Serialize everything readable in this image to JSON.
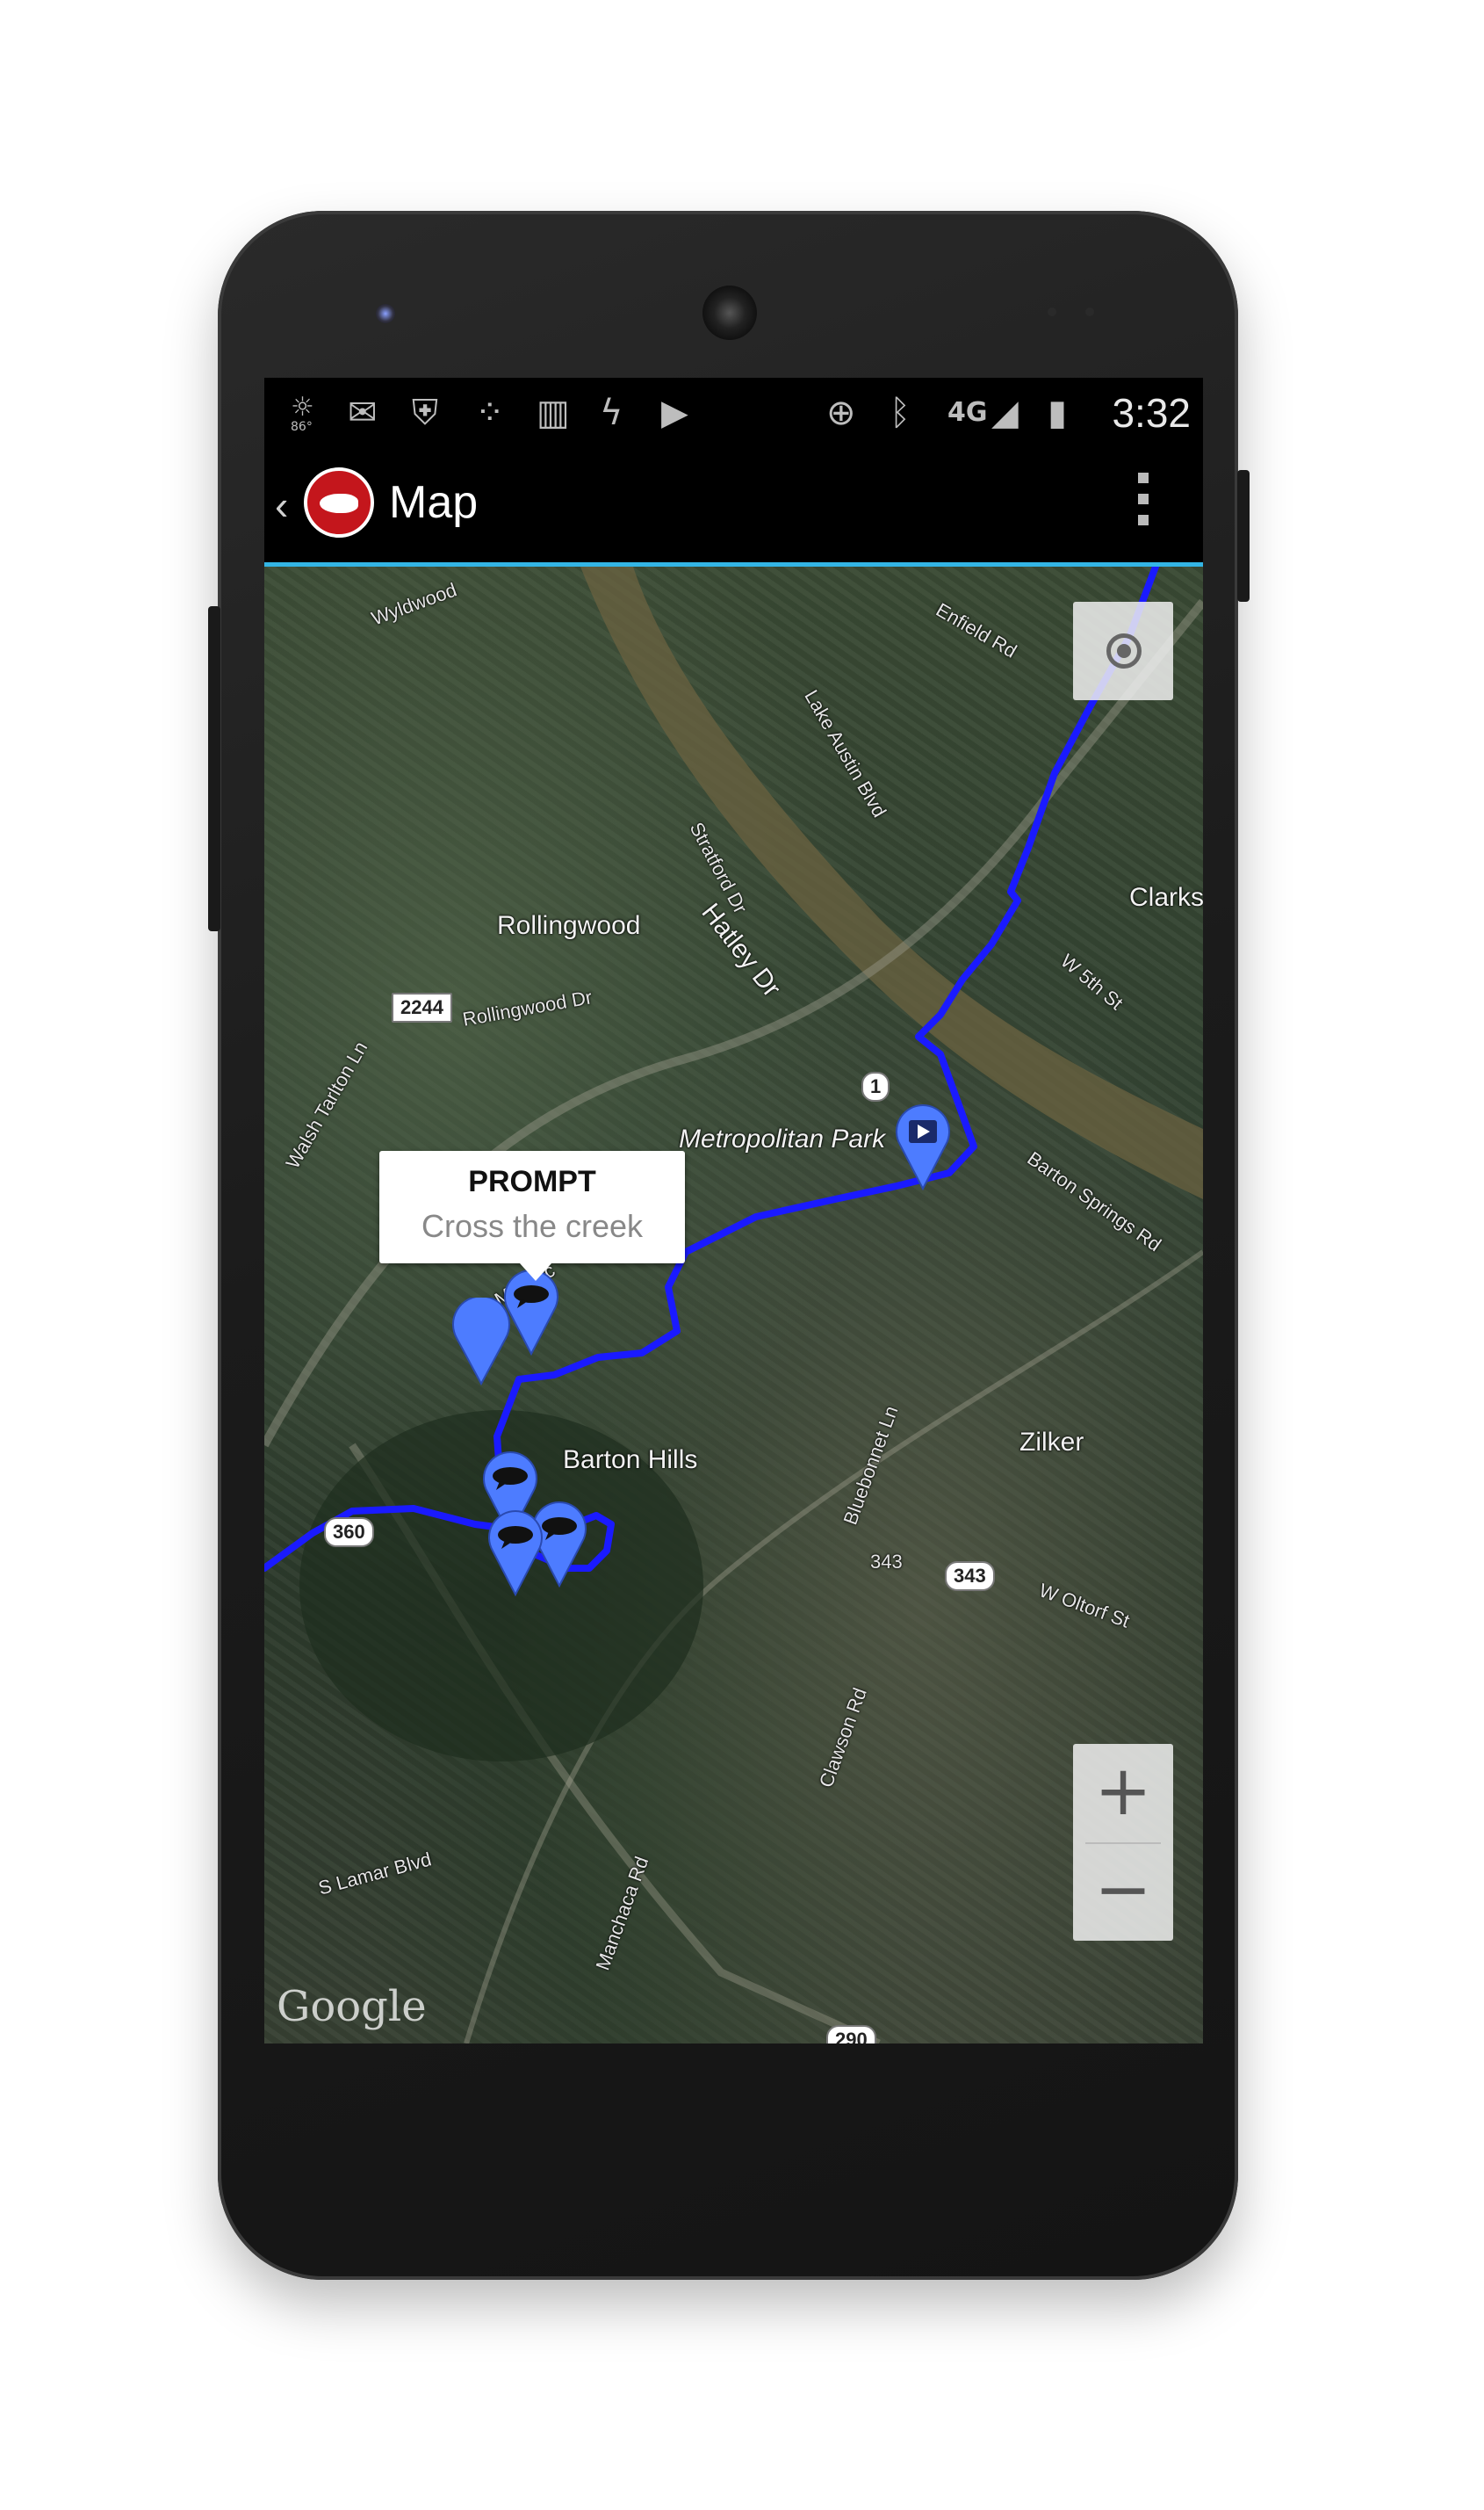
{
  "statusbar": {
    "icons": [
      "weather-icon",
      "gmail-icon",
      "shield-icon",
      "dots-icon",
      "barcode-icon",
      "charging-icon",
      "play-store-icon",
      "gps-icon",
      "bluetooth-icon",
      "network-icon",
      "signal-icon",
      "battery-icon"
    ],
    "weather_temp": "86°",
    "network_label": "4G",
    "time": "3:32"
  },
  "actionbar": {
    "title": "Map"
  },
  "map": {
    "labels": {
      "rollingwood": "Rollingwood",
      "hatley": "Hatley Dr",
      "metropolitan": "Metropolitan Park",
      "barton_hills": "Barton Hills",
      "zilker": "Zilker",
      "clarksville": "Clarks",
      "bluebonnet": "Bluebonnet Ln",
      "rollingwood_dr": "Rollingwood Dr",
      "stratford": "Stratford Dr",
      "lake_austin": "Lake Austin Blvd",
      "enfield": "Enfield Rd",
      "barton_springs": "Barton Springs Rd",
      "w_oltorf": "W Oltorf St",
      "s_lamar": "S Lamar Blvd",
      "s_mopac": "S Mo Pac",
      "w_5th": "W 5th St",
      "wallis": "Walsh Tarlton Ln",
      "wyldwood": "Wyldwood",
      "clawson": "Clawson Rd",
      "manchaca": "Manchaca Rd",
      "num_343": "343"
    },
    "shields": {
      "r2244": "2244",
      "r1": "1",
      "r360": "360",
      "r343": "343",
      "r290": "290"
    },
    "route_color": "#1e1eff",
    "pin_color": "#4d7cff",
    "attribution": "Google"
  },
  "popup": {
    "title": "PROMPT",
    "subtitle": "Cross the creek"
  },
  "controls": {
    "zoom_in": "+",
    "zoom_out": "−"
  }
}
